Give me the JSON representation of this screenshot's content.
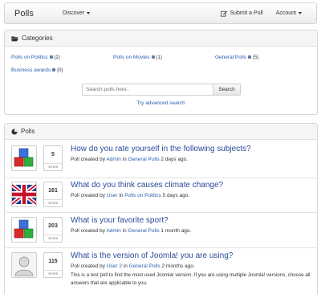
{
  "navbar": {
    "brand": "Polls",
    "discover": "Discover",
    "submit": "Submit a Poll",
    "account": "Account"
  },
  "categories": {
    "heading": "Categories",
    "items": [
      {
        "label": "Polls on Politics",
        "count": "(2)"
      },
      {
        "label": "Polls on Movies",
        "count": "(1)"
      },
      {
        "label": "General Polls",
        "count": "(5)"
      },
      {
        "label": "Business awards",
        "count": "(0)"
      }
    ],
    "search_placeholder": "Search polls here..",
    "search_button": "Search",
    "advanced_link": "Try advanced search"
  },
  "polls": {
    "heading": "Polls",
    "votes_label": "VOTES",
    "items": [
      {
        "votes": "5",
        "title": "How do you rate yourself in the following subjects?",
        "prefix": "Poll created by ",
        "author": "Admin",
        "mid": " in ",
        "category": "General Polls",
        "time": " 2 days ago.",
        "icon": "cubes-icon"
      },
      {
        "votes": "161",
        "title": "What do you think causes climate change?",
        "prefix": "Poll created by ",
        "author": "User",
        "mid": " in ",
        "category": "Polls on Politics",
        "time": " 5 days ago.",
        "icon": "uk-flag-icon"
      },
      {
        "votes": "203",
        "title": "What is your favorite sport?",
        "prefix": "Poll created by ",
        "author": "Admin",
        "mid": " in ",
        "category": "General Polls",
        "time": " 1 month ago.",
        "icon": "cubes-icon"
      },
      {
        "votes": "115",
        "title": "What is the version of Joomla! you are using?",
        "prefix": "Poll created by ",
        "author": "User 2",
        "mid": " in ",
        "category": "General Polls",
        "time": " 2 months ago.",
        "description": "This is a test poll to find the most used Joomla! version. If you are using multiple Joomla! versions, choose all answers that are applicable to you.",
        "icon": "avatar-icon"
      }
    ]
  }
}
